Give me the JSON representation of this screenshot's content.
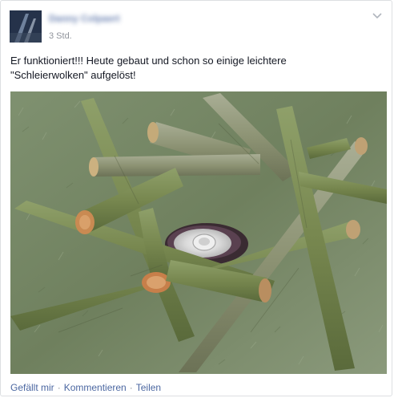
{
  "post": {
    "author": "Danny Colpaert",
    "timestamp": "3 Std.",
    "text_line1": "Er funktioniert!!! Heute gebaut und schon so einige leichtere",
    "text_line2": "\"Schleierwolken\" aufgelöst!"
  },
  "actions": {
    "like": "Gefällt mir",
    "comment": "Kommentieren",
    "share": "Teilen",
    "separator": "·"
  },
  "icons": {
    "menu": "chevron-down-icon"
  },
  "colors": {
    "link": "#4b67a1",
    "meta": "#90949c",
    "text": "#141823",
    "author": "#3b5998"
  }
}
